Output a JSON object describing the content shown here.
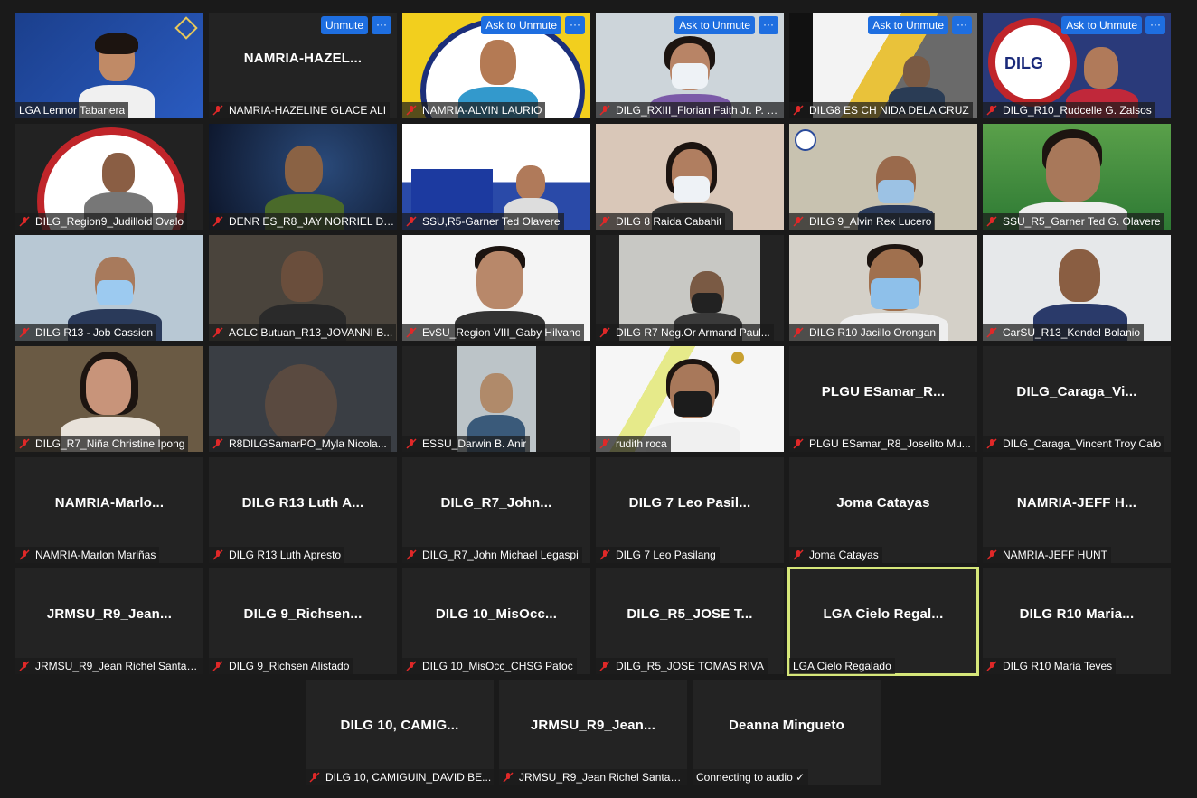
{
  "colors": {
    "background": "#1a1a1a",
    "tile": "#232323",
    "button": "#1e6ee0",
    "active_border": "#d6e77a",
    "mute_icon": "#e02828"
  },
  "participants": [
    {
      "name": "LGA Lennor Tabanera",
      "muted": false
    },
    {
      "name": "NAMRIA-HAZELINE GLACE ALI",
      "display": "NAMRIA-HAZEL...",
      "muted": true,
      "button": "Unmute"
    },
    {
      "name": "NAMRIA-ALVIN LAURIO",
      "muted": true,
      "button": "Ask to Unmute"
    },
    {
      "name": "DILG_RXIII_Florian Faith Jr. P. B...",
      "muted": true,
      "button": "Ask to Unmute"
    },
    {
      "name": "DILG8 ES CH NIDA DELA CRUZ",
      "muted": true,
      "button": "Ask to Unmute"
    },
    {
      "name": "DILG_R10_Rudcelle G. Zalsos",
      "muted": true,
      "button": "Ask to Unmute"
    },
    {
      "name": "DILG_Region9_Judilloid Ovalo",
      "muted": true
    },
    {
      "name": "DENR ES_R8_JAY NORRIEL DE...",
      "muted": true
    },
    {
      "name": "SSU,R5-Garner Ted Olavere",
      "muted": true
    },
    {
      "name": "DILG 8 Raida Cabahit",
      "muted": true
    },
    {
      "name": "DILG 9_Alvin Rex Lucero",
      "muted": true
    },
    {
      "name": "SSU_R5_Garner Ted G. Olavere",
      "muted": true
    },
    {
      "name": "DILG R13 - Job Cassion",
      "muted": true
    },
    {
      "name": "ACLC Butuan_R13_JOVANNI B...",
      "muted": true
    },
    {
      "name": "EvSU_Region VIII_Gaby Hilvano",
      "muted": true
    },
    {
      "name": "DILG R7 Neg.Or Armand Paul...",
      "muted": true
    },
    {
      "name": "DILG R10 Jacillo Orongan",
      "muted": true
    },
    {
      "name": "CarSU_R13_Kendel Bolanio",
      "muted": true
    },
    {
      "name": "DILG_R7_Niña Christine Ipong",
      "muted": true
    },
    {
      "name": "R8DILGSamarPO_Myla Nicola...",
      "muted": true
    },
    {
      "name": "ESSU_Darwin B. Anir",
      "muted": true
    },
    {
      "name": "rudith roca",
      "muted": true
    },
    {
      "name": "PLGU ESamar_R8_Joselito Mu...",
      "display": "PLGU ESamar_R...",
      "muted": true
    },
    {
      "name": "DILG_Caraga_Vincent Troy Calo",
      "display": "DILG_Caraga_Vi...",
      "muted": true
    },
    {
      "name": "NAMRIA-Marlon Mariñas",
      "display": "NAMRIA-Marlo...",
      "muted": true
    },
    {
      "name": "DILG R13 Luth Apresto",
      "display": "DILG R13 Luth A...",
      "muted": true
    },
    {
      "name": "DILG_R7_John Michael Legaspi",
      "display": "DILG_R7_John...",
      "muted": true
    },
    {
      "name": "DILG 7 Leo Pasilang",
      "display": "DILG 7 Leo Pasil...",
      "muted": true
    },
    {
      "name": "Joma Catayas",
      "display": "Joma Catayas",
      "muted": true
    },
    {
      "name": "NAMRIA-JEFF HUNT",
      "display": "NAMRIA-JEFF H...",
      "muted": true
    },
    {
      "name": "JRMSU_R9_Jean Richel Santan...",
      "display": "JRMSU_R9_Jean...",
      "muted": true
    },
    {
      "name": "DILG 9_Richsen Alistado",
      "display": "DILG 9_Richsen...",
      "muted": true
    },
    {
      "name": "DILG 10_MisOcc_CHSG Patoc",
      "display": "DILG 10_MisOcc...",
      "muted": true
    },
    {
      "name": "DILG_R5_JOSE TOMAS RIVA",
      "display": "DILG_R5_JOSE T...",
      "muted": true
    },
    {
      "name": "LGA Cielo Regalado",
      "display": "LGA Cielo Regal...",
      "muted": false,
      "active": true
    },
    {
      "name": "DILG R10 Maria Teves",
      "display": "DILG R10 Maria...",
      "muted": true
    },
    {
      "name": "DILG 10, CAMIGUIN_DAVID BE...",
      "display": "DILG 10, CAMIG...",
      "muted": true
    },
    {
      "name": "JRMSU_R9_Jean Richel Santan...",
      "display": "JRMSU_R9_Jean...",
      "muted": true
    },
    {
      "name": "Connecting to audio ✓",
      "display": "Deanna Mingueto",
      "muted": false
    }
  ]
}
